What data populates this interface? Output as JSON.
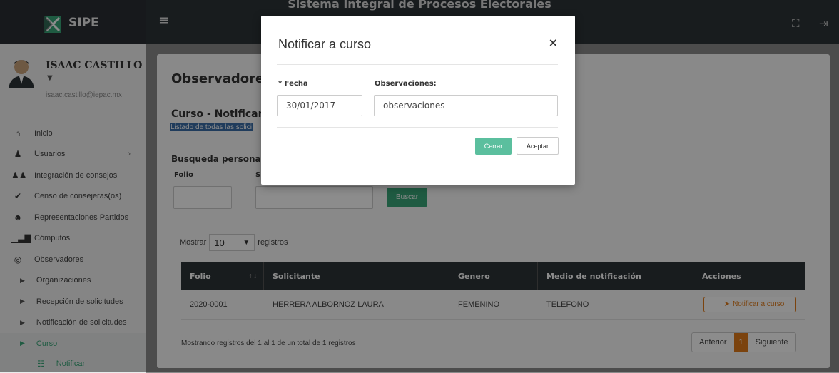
{
  "app": {
    "brand": "SIPE",
    "system_title": "Sistema Integral de Procesos Electorales"
  },
  "user": {
    "name": "ISAAC CASTILLO",
    "email": "isaac.castillo@iepac.mx"
  },
  "sidebar": {
    "items": [
      {
        "label": "Inicio",
        "icon": "home-icon"
      },
      {
        "label": "Usuarios",
        "icon": "users-icon",
        "has_submenu": true
      },
      {
        "label": "Integración de consejos",
        "icon": "group-icon"
      },
      {
        "label": "Censo de consejeras(os)",
        "icon": "check-icon"
      },
      {
        "label": "Representaciones Partidos",
        "icon": "people-icon"
      },
      {
        "label": "Cómputos",
        "icon": "bar-chart-icon"
      },
      {
        "label": "Observadores",
        "icon": "eye-icon"
      }
    ],
    "subitems": [
      {
        "label": "Organizaciones"
      },
      {
        "label": "Recepción de solicitudes"
      },
      {
        "label": "Notificación de solicitudes"
      },
      {
        "label": "Curso"
      }
    ],
    "active_sub": "Notificar"
  },
  "main": {
    "title": "Observadores",
    "section_title": "Curso - Notificar",
    "section_subtitle": "Listado de todas las solici",
    "search_title": "Busqueda personaliz",
    "folio_label": "Folio",
    "solicitante_label": "S",
    "search_button": "Buscar",
    "show_prefix": "Mostrar",
    "show_value": "10",
    "show_suffix": "registros",
    "columns": [
      "Folio",
      "Solicitante",
      "Genero",
      "Medio de notificación",
      "Acciones"
    ],
    "rows": [
      {
        "folio": "2020-0001",
        "solicitante": "HERRERA ALBORNOZ LAURA",
        "genero": "FEMENINO",
        "medio": "TELEFONO",
        "action": "Notificar a curso"
      }
    ],
    "info": "Mostrando registros del 1 al 1 de un total de 1 registros",
    "pager": {
      "prev": "Anterior",
      "current": "1",
      "next": "Siguiente"
    }
  },
  "modal": {
    "title": "Notificar a curso",
    "close": "×",
    "fecha_label": "* Fecha",
    "fecha_value": "30/01/2017",
    "obs_label": "Observaciones:",
    "obs_value": "observaciones",
    "cancel": "Cerrar",
    "accept": "Aceptar"
  },
  "colors": {
    "topbar": "#2d3338",
    "accent_green": "#3aa678",
    "accent_orange": "#e07b1a",
    "highlight_blue": "#3b6ea8"
  }
}
